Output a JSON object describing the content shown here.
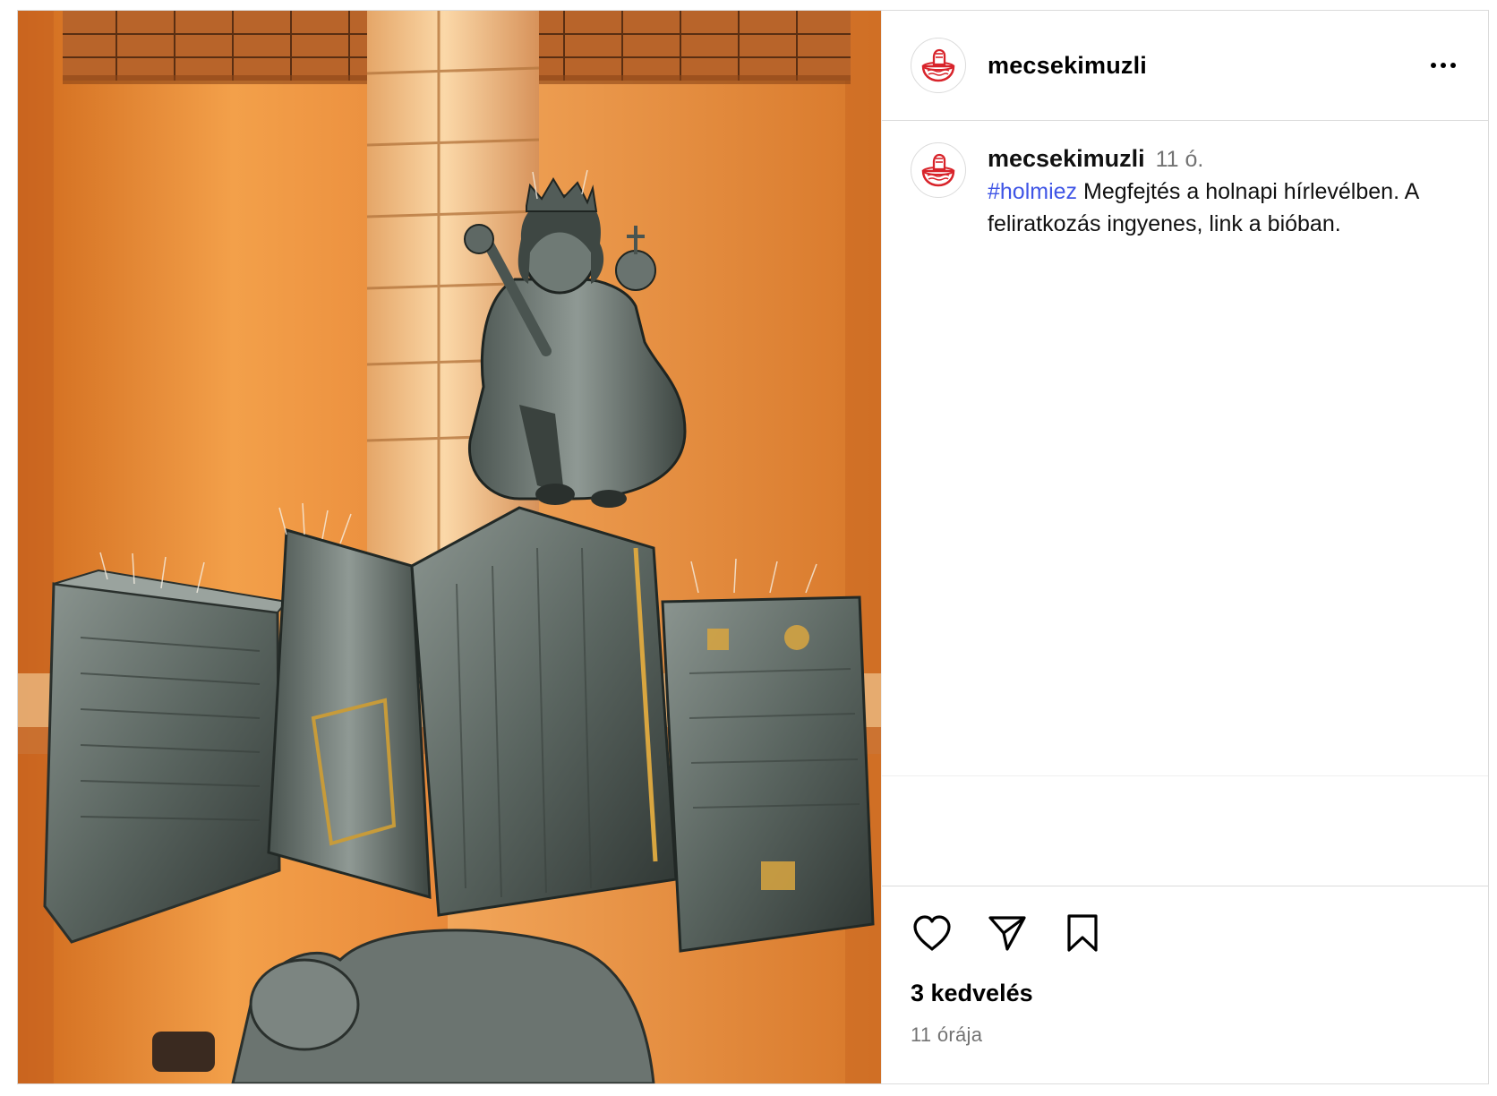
{
  "header": {
    "username": "mecsekimuzli",
    "avatar_icon": "fist-in-bowl-logo-icon",
    "more_icon": "more-options-icon"
  },
  "caption": {
    "username": "mecsekimuzli",
    "time": "11 ó.",
    "hashtag": "#holmiez",
    "text": " Megfejtés a holnapi hírlevélben. A feliratkozás ingyenes, link a bióban."
  },
  "actions": {
    "like_icon": "heart-icon",
    "share_icon": "paper-plane-icon",
    "save_icon": "bookmark-icon",
    "likes": "3 kedvelés",
    "timestamp": "11 órája"
  },
  "colors": {
    "brand_red": "#d8232a",
    "hashtag_blue": "#3f55e6",
    "muted_gray": "#737373",
    "border": "#dbdbdb"
  }
}
